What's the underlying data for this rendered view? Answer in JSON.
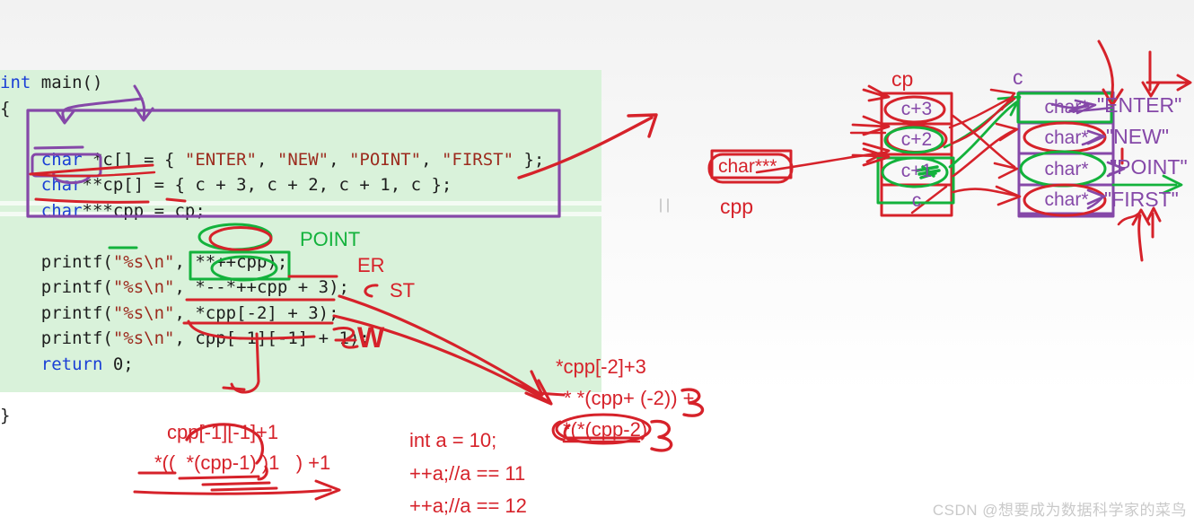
{
  "code": {
    "lines": [
      [
        {
          "t": "int ",
          "c": "kw"
        },
        {
          "t": "main()",
          "c": "pl"
        }
      ],
      [
        {
          "t": "{",
          "c": "pl"
        }
      ],
      [
        {
          "t": "    ",
          "c": "pl"
        }
      ],
      [
        {
          "t": "    ",
          "c": "pl"
        },
        {
          "t": "char",
          "c": "kw"
        },
        {
          "t": " *c[] = { ",
          "c": "pl"
        },
        {
          "t": "\"ENTER\"",
          "c": "str"
        },
        {
          "t": ", ",
          "c": "pl"
        },
        {
          "t": "\"NEW\"",
          "c": "str"
        },
        {
          "t": ", ",
          "c": "pl"
        },
        {
          "t": "\"POINT\"",
          "c": "str"
        },
        {
          "t": ", ",
          "c": "pl"
        },
        {
          "t": "\"FIRST\"",
          "c": "str"
        },
        {
          "t": " };",
          "c": "pl"
        }
      ],
      [
        {
          "t": "    ",
          "c": "pl"
        },
        {
          "t": "char",
          "c": "kw"
        },
        {
          "t": "**cp[] = { c + 3, c + 2, c + 1, c };",
          "c": "pl"
        }
      ],
      [
        {
          "t": "    ",
          "c": "pl"
        },
        {
          "t": "char",
          "c": "kw"
        },
        {
          "t": "***cpp = cp;",
          "c": "pl"
        }
      ],
      [
        {
          "t": "",
          "c": "pl"
        }
      ],
      [
        {
          "t": "    printf(",
          "c": "pl"
        },
        {
          "t": "\"%s\\n\"",
          "c": "str"
        },
        {
          "t": ", **++cpp);",
          "c": "pl"
        }
      ],
      [
        {
          "t": "    printf(",
          "c": "pl"
        },
        {
          "t": "\"%s\\n\"",
          "c": "str"
        },
        {
          "t": ", *--*++cpp + 3);",
          "c": "pl"
        }
      ],
      [
        {
          "t": "    printf(",
          "c": "pl"
        },
        {
          "t": "\"%s\\n\"",
          "c": "str"
        },
        {
          "t": ", *cpp[-2] + 3);",
          "c": "pl"
        }
      ],
      [
        {
          "t": "    printf(",
          "c": "pl"
        },
        {
          "t": "\"%s\\n\"",
          "c": "str"
        },
        {
          "t": ", cpp[-1][-1] + 1);",
          "c": "pl"
        }
      ],
      [
        {
          "t": "    ",
          "c": "pl"
        },
        {
          "t": "return",
          "c": "kw"
        },
        {
          "t": " 0;",
          "c": "pl"
        }
      ],
      [
        {
          "t": "",
          "c": "pl"
        }
      ],
      [
        {
          "t": "}",
          "c": "pl"
        }
      ]
    ]
  },
  "inline_notes": {
    "point": "POINT",
    "er": "ER",
    "st": "ST",
    "w": "W"
  },
  "diagram": {
    "cpp_label": "cpp",
    "cpp_box_text": "char***",
    "cp_label": "cp",
    "c_label": "c",
    "cp_cells": [
      "c+3",
      "c+2",
      "c+1",
      "c"
    ],
    "c_cells": [
      "char*",
      "char*",
      "char*",
      "char*"
    ],
    "strings": [
      "\"ENTER\"",
      "\"NEW\"",
      "\"POINT\"",
      "\"FIRST\""
    ]
  },
  "notes": {
    "expr1": "*cpp[-2]+3",
    "expr2": "* *(cpp+ (-2)) +",
    "expr2_tail": "3",
    "expr3": "*(*(cpp-2)",
    "expr3_tail": "+3",
    "expr4": "cpp[-1][-1]+1",
    "expr5": "*((  *(cpp-1) )1   ) +1",
    "inc1": "int a = 10;",
    "inc2": "++a;//a == 11",
    "inc3": "++a;//a == 12"
  },
  "watermark": "CSDN @想要成为数据科学家的菜鸟",
  "colors": {
    "red": "#d6222a",
    "green": "#13b23c",
    "purple": "#8548a8",
    "code_bg": "#d9f2da",
    "keyword": "#1a3fd6",
    "string": "#9c2b1e"
  }
}
